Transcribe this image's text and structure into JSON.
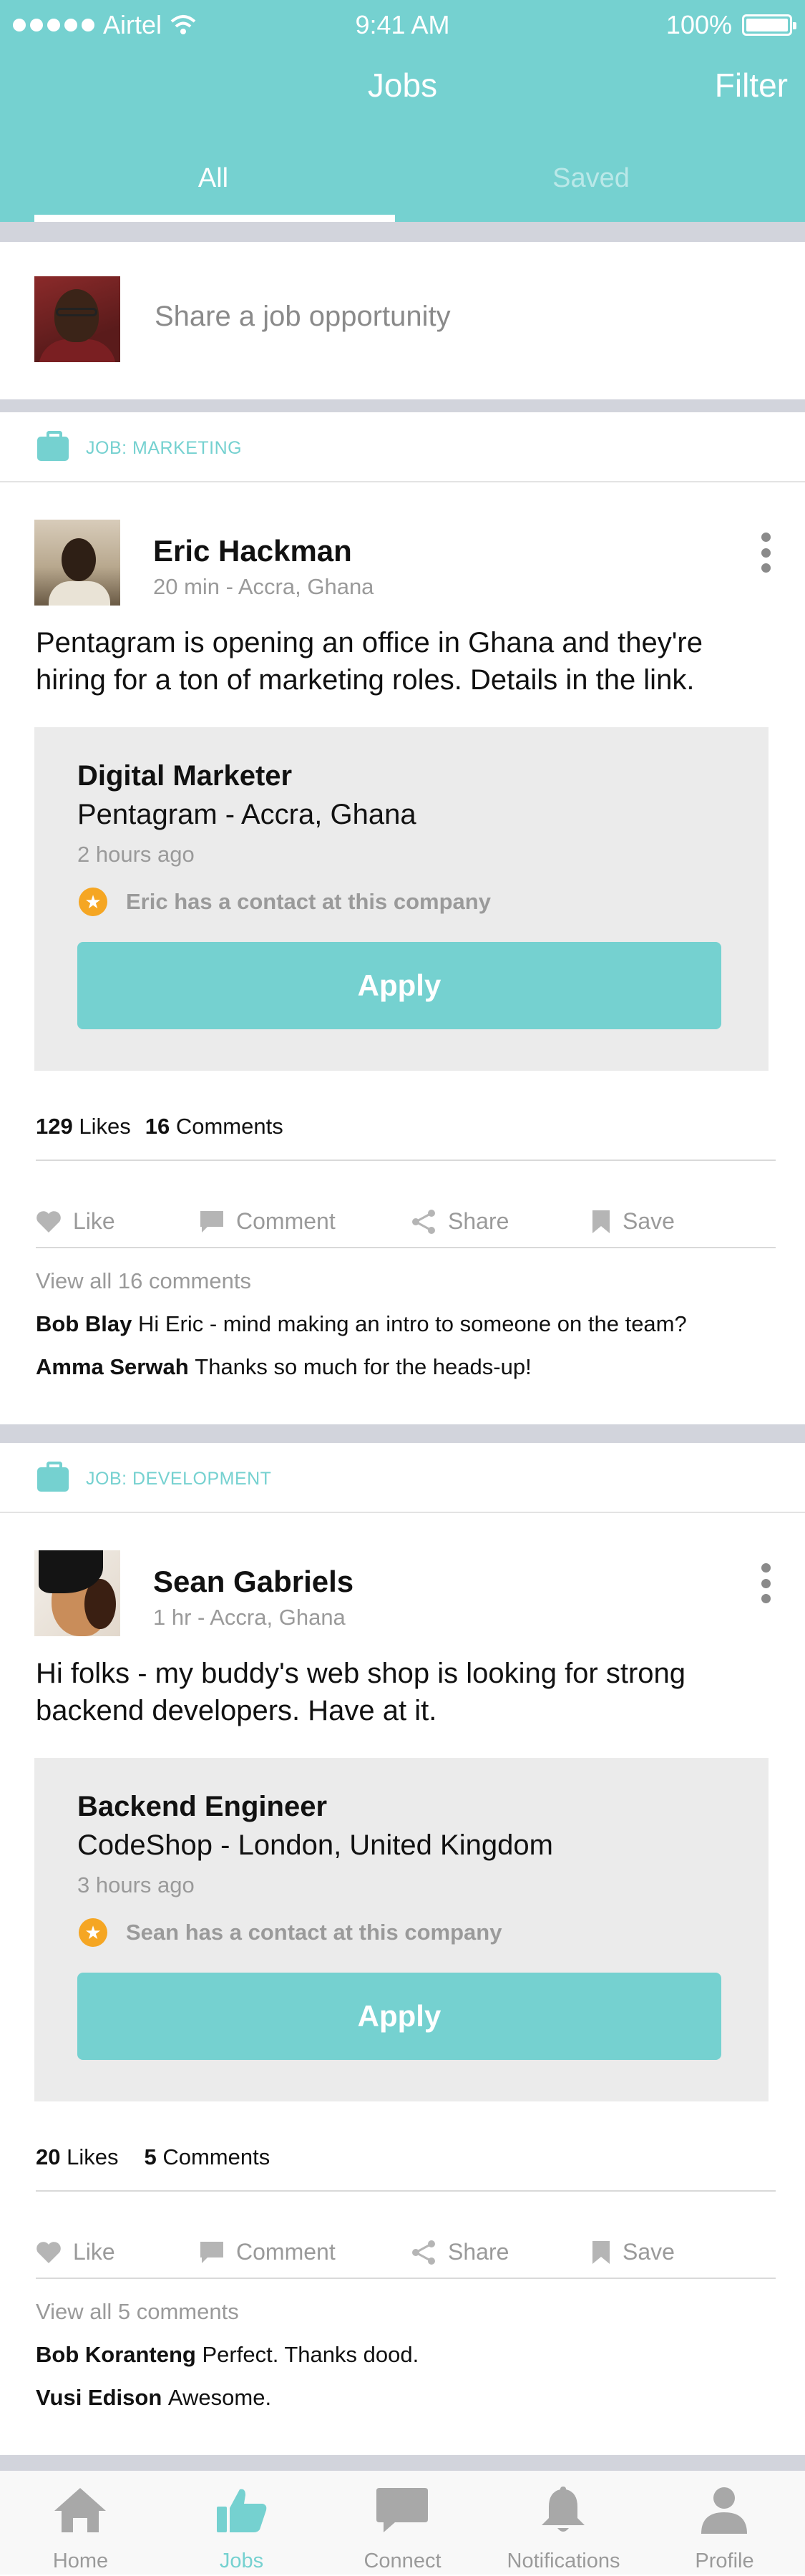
{
  "status_bar": {
    "carrier": "Airtel",
    "time": "9:41 AM",
    "battery": "100%"
  },
  "nav": {
    "title": "Jobs",
    "filter_label": "Filter"
  },
  "tabs": [
    {
      "label": "All"
    },
    {
      "label": "Saved"
    }
  ],
  "share": {
    "placeholder": "Share a job opportunity"
  },
  "posts": [
    {
      "category": "JOB: MARKETING",
      "author": "Eric Hackman",
      "meta": "20 min - Accra, Ghana",
      "text": "Pentagram is opening an office in Ghana and they're hiring for a ton of marketing roles. Details in the link.",
      "job": {
        "title": "Digital Marketer",
        "company": "Pentagram - Accra, Ghana",
        "ago": "2 hours ago",
        "contact": "Eric has a contact at this company",
        "apply_label": "Apply"
      },
      "likes": "129",
      "likes_label": "Likes",
      "comments": "16",
      "comments_label": "Comments",
      "actions": {
        "like": "Like",
        "comment": "Comment",
        "share": "Share",
        "save": "Save"
      },
      "view_all": "View all 16 comments",
      "comment_list": [
        {
          "name": "Bob Blay",
          "text": "Hi Eric - mind making an intro to someone on the team?"
        },
        {
          "name": "Amma Serwah",
          "text": "Thanks so much for the heads-up!"
        }
      ]
    },
    {
      "category": "JOB: DEVELOPMENT",
      "author": "Sean Gabriels",
      "meta": "1 hr - Accra, Ghana",
      "text": "Hi folks - my buddy's web shop is looking for strong backend developers. Have at it.",
      "job": {
        "title": "Backend Engineer",
        "company": "CodeShop - London, United Kingdom",
        "ago": "3 hours ago",
        "contact": "Sean has a contact at this company",
        "apply_label": "Apply"
      },
      "likes": "20",
      "likes_label": "Likes",
      "comments": "5",
      "comments_label": "Comments",
      "actions": {
        "like": "Like",
        "comment": "Comment",
        "share": "Share",
        "save": "Save"
      },
      "view_all": "View all 5 comments",
      "comment_list": [
        {
          "name": "Bob Koranteng",
          "text": "Perfect. Thanks dood."
        },
        {
          "name": "Vusi Edison",
          "text": "Awesome."
        }
      ]
    }
  ],
  "tab_bar": [
    {
      "label": "Home",
      "icon": "home-icon"
    },
    {
      "label": "Jobs",
      "icon": "thumbs-up-icon",
      "active": true
    },
    {
      "label": "Connect",
      "icon": "chat-icon"
    },
    {
      "label": "Notifications",
      "icon": "bell-icon"
    },
    {
      "label": "Profile",
      "icon": "person-icon"
    }
  ],
  "colors": {
    "accent": "#75d1d0",
    "star": "#f5a623",
    "separator": "#d2d4dc",
    "card": "#ebebeb"
  }
}
